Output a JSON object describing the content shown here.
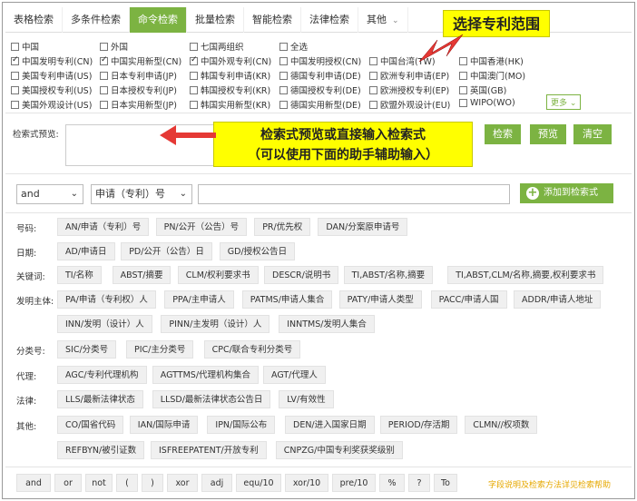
{
  "tabs": [
    "表格检索",
    "多条件检索",
    "命令检索",
    "批量检索",
    "智能检索",
    "法律检索",
    "其他"
  ],
  "active_tab": "命令检索",
  "scope": [
    {
      "label": "中国",
      "checked": false,
      "col": 0,
      "row": 0
    },
    {
      "label": "外国",
      "checked": false,
      "col": 1,
      "row": 0
    },
    {
      "label": "七国两组织",
      "checked": false,
      "col": 2,
      "row": 0
    },
    {
      "label": "全选",
      "checked": false,
      "col": 3,
      "row": 0
    },
    {
      "label": "中国发明专利(CN)",
      "checked": true,
      "col": 0,
      "row": 1
    },
    {
      "label": "中国实用新型(CN)",
      "checked": true,
      "col": 1,
      "row": 1
    },
    {
      "label": "中国外观专利(CN)",
      "checked": true,
      "col": 2,
      "row": 1
    },
    {
      "label": "中国发明授权(CN)",
      "checked": false,
      "col": 3,
      "row": 1
    },
    {
      "label": "中国台湾(TW)",
      "checked": false,
      "col": 4,
      "row": 1
    },
    {
      "label": "中国香港(HK)",
      "checked": false,
      "col": 5,
      "row": 1
    },
    {
      "label": "美国专利申请(US)",
      "checked": false,
      "col": 0,
      "row": 2
    },
    {
      "label": "日本专利申请(JP)",
      "checked": false,
      "col": 1,
      "row": 2
    },
    {
      "label": "韩国专利申请(KR)",
      "checked": false,
      "col": 2,
      "row": 2
    },
    {
      "label": "德国专利申请(DE)",
      "checked": false,
      "col": 3,
      "row": 2
    },
    {
      "label": "欧洲专利申请(EP)",
      "checked": false,
      "col": 4,
      "row": 2
    },
    {
      "label": "中国澳门(MO)",
      "checked": false,
      "col": 5,
      "row": 2
    },
    {
      "label": "美国授权专利(US)",
      "checked": false,
      "col": 0,
      "row": 3
    },
    {
      "label": "日本授权专利(JP)",
      "checked": false,
      "col": 1,
      "row": 3
    },
    {
      "label": "韩国授权专利(KR)",
      "checked": false,
      "col": 2,
      "row": 3
    },
    {
      "label": "德国授权专利(DE)",
      "checked": false,
      "col": 3,
      "row": 3
    },
    {
      "label": "欧洲授权专利(EP)",
      "checked": false,
      "col": 4,
      "row": 3
    },
    {
      "label": "英国(GB)",
      "checked": false,
      "col": 5,
      "row": 3
    },
    {
      "label": "美国外观设计(US)",
      "checked": false,
      "col": 0,
      "row": 4
    },
    {
      "label": "日本实用新型(JP)",
      "checked": false,
      "col": 1,
      "row": 4
    },
    {
      "label": "韩国实用新型(KR)",
      "checked": false,
      "col": 2,
      "row": 4
    },
    {
      "label": "德国实用新型(DE)",
      "checked": false,
      "col": 3,
      "row": 4
    },
    {
      "label": "欧盟外观设计(EU)",
      "checked": false,
      "col": 4,
      "row": 4
    },
    {
      "label": "WIPO(WO)",
      "checked": false,
      "col": 5,
      "row": 4
    }
  ],
  "more_label": "更多",
  "preview_label": "检索式预览:",
  "buttons": {
    "search": "检索",
    "preview": "预览",
    "clear": "清空"
  },
  "operator_select": "and",
  "field_select": "申请（专利）号",
  "add_button": "添加到检索式",
  "helper": [
    {
      "label": "号码:",
      "chips": [
        "AN/申请（专利）号",
        "PN/公开（公告）号",
        "PR/优先权",
        "DAN/分案原申请号"
      ]
    },
    {
      "label": "日期:",
      "chips": [
        "AD/申请日",
        "PD/公开（公告）日",
        "GD/授权公告日"
      ]
    },
    {
      "label": "关键词:",
      "chips": [
        "TI/名称",
        "ABST/摘要",
        "CLM/权利要求书",
        "DESCR/说明书",
        "TI,ABST/名称,摘要",
        "TI,ABST,CLM/名称,摘要,权利要求书"
      ]
    },
    {
      "label": "发明主体:",
      "chips": [
        "PA/申请（专利权）人",
        "PPA/主申请人",
        "PATMS/申请人集合",
        "PATY/申请人类型",
        "PACC/申请人国",
        "ADDR/申请人地址"
      ]
    },
    {
      "label": "",
      "chips": [
        "INN/发明（设计）人",
        "PINN/主发明（设计）人",
        "INNTMS/发明人集合"
      ]
    },
    {
      "label": "分类号:",
      "chips": [
        "SIC/分类号",
        "PIC/主分类号",
        "CPC/联合专利分类号"
      ]
    },
    {
      "label": "代理:",
      "chips": [
        "AGC/专利代理机构",
        "AGTTMS/代理机构集合",
        "AGT/代理人"
      ]
    },
    {
      "label": "法律:",
      "chips": [
        "LLS/最新法律状态",
        "LLSD/最新法律状态公告日",
        "LV/有效性"
      ]
    },
    {
      "label": "其他:",
      "chips": [
        "CO/国省代码",
        "IAN/国际申请",
        "IPN/国际公布",
        "DEN/进入国家日期",
        "PERIOD/存活期",
        "CLMN//权项数"
      ]
    },
    {
      "label": "",
      "chips": [
        "REFBYN/被引证数",
        "ISFREEPATENT/开放专利",
        "CNPZG/中国专利奖获奖级别"
      ]
    }
  ],
  "bottom_ops": [
    "and",
    "or",
    "not",
    "(",
    ")",
    "xor",
    "adj",
    "equ/10",
    "xor/10",
    "pre/10",
    "%",
    "?",
    "To"
  ],
  "help_link": "字段说明及检索方法详见检索帮助",
  "callouts": {
    "scope": "选择专利范围",
    "preview_line1": "检索式预览或直接输入检索式",
    "preview_line2": "（可以使用下面的助手辅助输入）"
  },
  "colors": {
    "accent": "#7cb342",
    "callout_bg": "#ffff00",
    "arrow": "#e53935"
  }
}
